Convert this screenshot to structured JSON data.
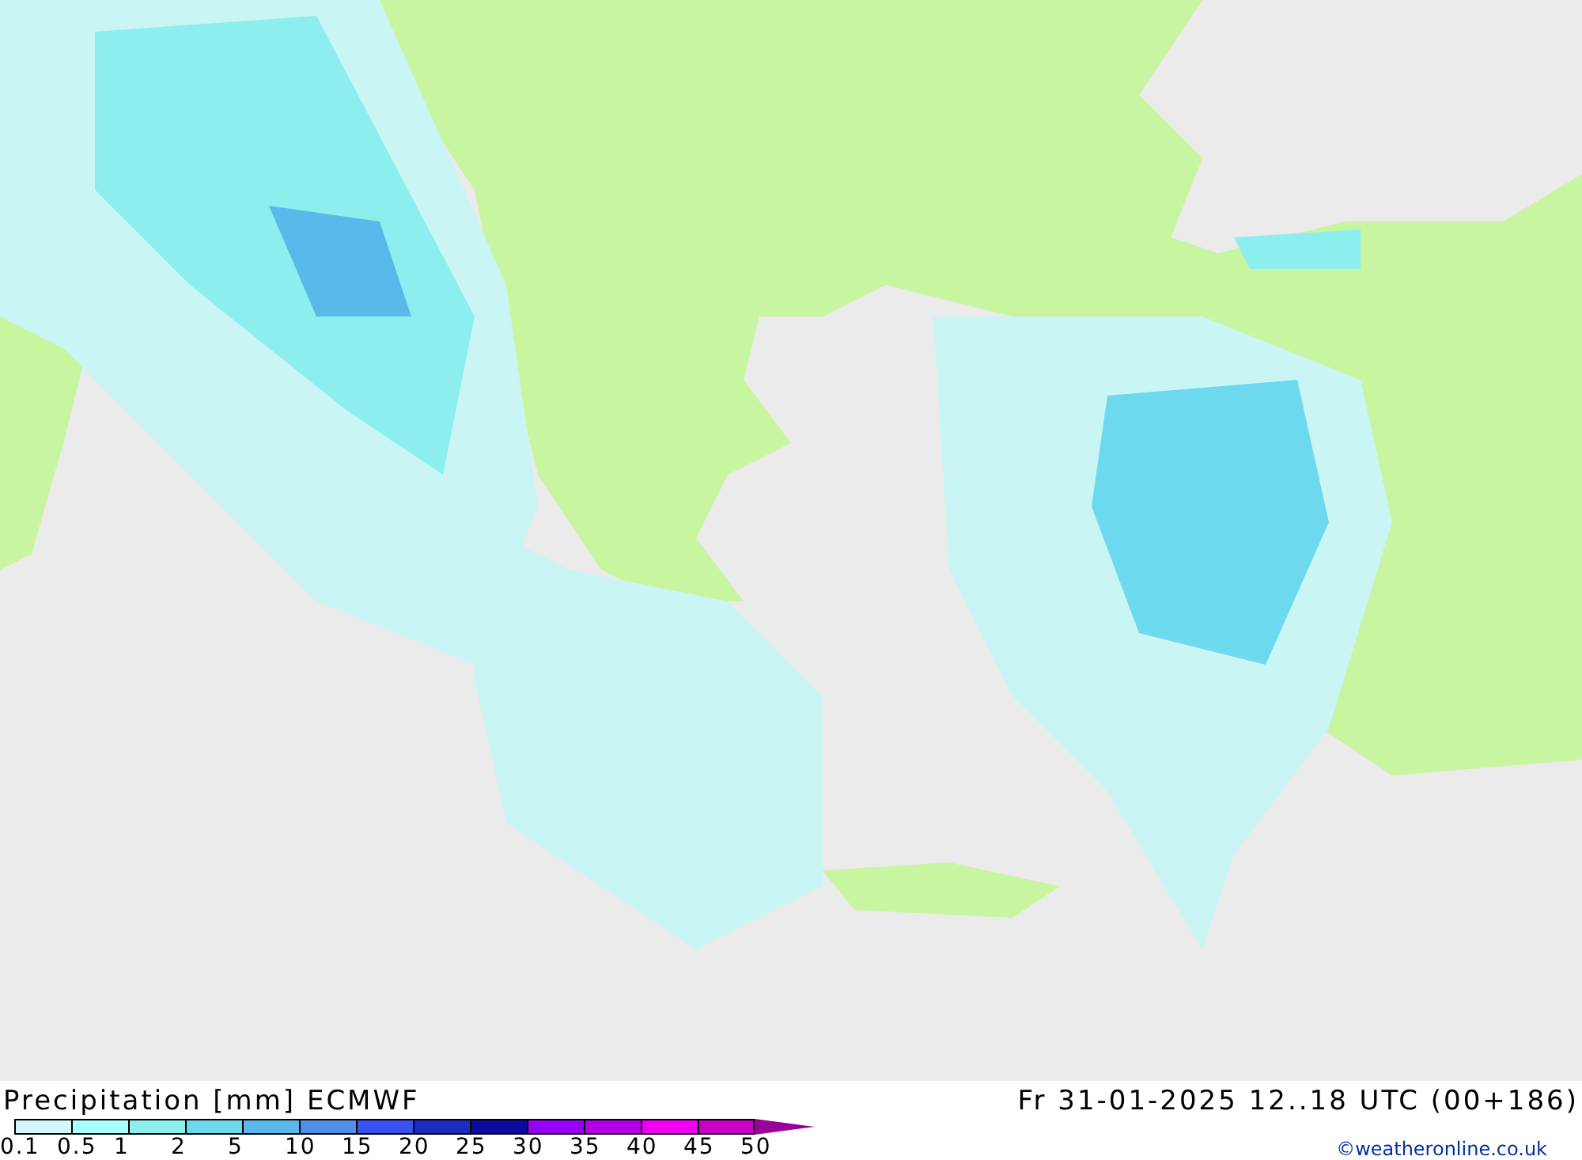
{
  "title": "Precipitation [mm] ECMWF",
  "valid_time": "Fr 31-01-2025 12..18 UTC (00+186)",
  "legend": {
    "swatches": [
      {
        "color": "#d4f7f7"
      },
      {
        "color": "#aaffff"
      },
      {
        "color": "#8deeee"
      },
      {
        "color": "#6dd9ee"
      },
      {
        "color": "#5ab9ea"
      },
      {
        "color": "#5090e8"
      },
      {
        "color": "#3a50f0"
      },
      {
        "color": "#1c2bc0"
      },
      {
        "color": "#0a0a9e"
      },
      {
        "color": "#9600f5"
      },
      {
        "color": "#b400e6"
      },
      {
        "color": "#f000f0"
      },
      {
        "color": "#c800c8"
      }
    ],
    "labels": [
      "0.1",
      "0.5",
      "1",
      "2",
      "5",
      "10",
      "15",
      "20",
      "25",
      "30",
      "35",
      "40",
      "45",
      "50"
    ]
  },
  "credit": "©weatheronline.co.uk"
}
